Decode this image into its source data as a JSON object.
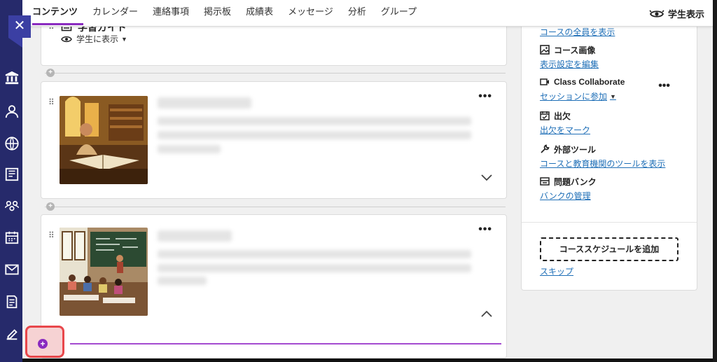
{
  "nav": {
    "tabs": [
      {
        "label": "コンテンツ",
        "active": true
      },
      {
        "label": "カレンダー"
      },
      {
        "label": "連絡事項"
      },
      {
        "label": "掲示板"
      },
      {
        "label": "成績表"
      },
      {
        "label": "メッセージ"
      },
      {
        "label": "分析"
      },
      {
        "label": "グループ"
      }
    ],
    "student_view": "学生表示"
  },
  "guide": {
    "title": "学習ガイド",
    "visibility": "学生に表示"
  },
  "sidebar": {
    "top_link": "コースの全員を表示",
    "items": [
      {
        "heading": "コース画像",
        "link": "表示設定を編集",
        "icon": "image-icon"
      },
      {
        "heading": "Class Collaborate",
        "link": "セッションに参加",
        "icon": "video-icon"
      },
      {
        "heading": "出欠",
        "link": "出欠をマーク",
        "icon": "attendance-icon"
      },
      {
        "heading": "外部ツール",
        "link": "コースと教育機関のツールを表示",
        "icon": "wrench-icon"
      },
      {
        "heading": "問題バンク",
        "link": "バンクの管理",
        "icon": "bank-icon"
      }
    ],
    "schedule_button": "コーススケジュールを追加",
    "skip": "スキップ"
  },
  "colors": {
    "accent": "#8a2bbf",
    "link": "#1f6fb7",
    "rail": "#262a6b",
    "highlight": "#e8474b"
  }
}
